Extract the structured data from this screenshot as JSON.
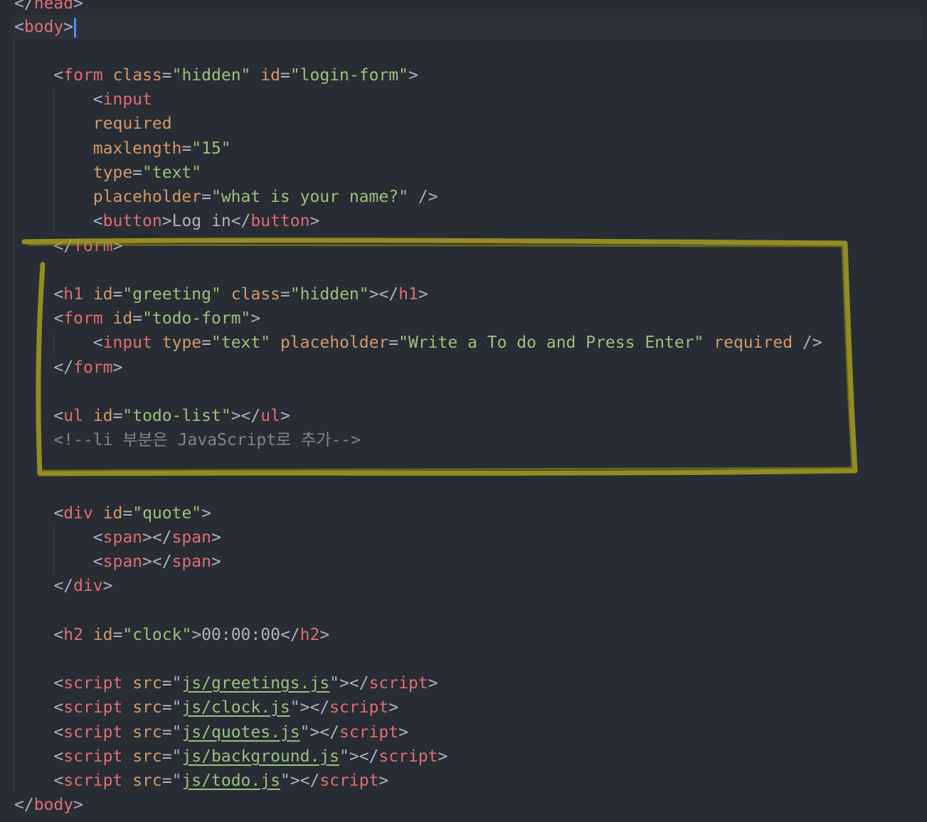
{
  "editor": {
    "language": "html",
    "colors": {
      "background": "#282c34",
      "tag": "#e06c75",
      "attribute": "#d19a66",
      "string": "#98c379",
      "punctuation": "#abb2bf",
      "comment": "#7f848e",
      "annotation": "#a69e1e",
      "cursor": "#528bff"
    },
    "annotation": {
      "shape": "hand-drawn rectangle",
      "color": "#a69e1e"
    },
    "code": {
      "head_close": "head",
      "body_open": "body",
      "login_form": {
        "tag": "form",
        "class_attr": "class",
        "class_val": "\"hidden\"",
        "id_attr": "id",
        "id_val": "\"login-form\""
      },
      "login_input": {
        "tag": "input",
        "required": "required",
        "maxlength_attr": "maxlength",
        "maxlength_val": "\"15\"",
        "type_attr": "type",
        "type_val": "\"text\"",
        "placeholder_attr": "placeholder",
        "placeholder_val": "\"what is your name?\""
      },
      "login_button": {
        "tag": "button",
        "text": "Log in"
      },
      "form_close": "form",
      "greeting": {
        "tag": "h1",
        "id_attr": "id",
        "id_val": "\"greeting\"",
        "class_attr": "class",
        "class_val": "\"hidden\""
      },
      "todo_form": {
        "tag": "form",
        "id_attr": "id",
        "id_val": "\"todo-form\""
      },
      "todo_input": {
        "tag": "input",
        "type_attr": "type",
        "type_val": "\"text\"",
        "placeholder_attr": "placeholder",
        "placeholder_val": "\"Write a To do and Press Enter\"",
        "required": "required"
      },
      "todo_list": {
        "tag": "ul",
        "id_attr": "id",
        "id_val": "\"todo-list\""
      },
      "comment": "<!--li 부분은 JavaScript로 추가-->",
      "quote": {
        "tag": "div",
        "id_attr": "id",
        "id_val": "\"quote\"",
        "span_tag": "span"
      },
      "clock": {
        "tag": "h2",
        "id_attr": "id",
        "id_val": "\"clock\"",
        "text": "00:00:00"
      },
      "script_tag": "script",
      "src_attr": "src",
      "scripts": [
        "js/greetings.js",
        "js/clock.js",
        "js/quotes.js",
        "js/background.js",
        "js/todo.js"
      ]
    }
  }
}
